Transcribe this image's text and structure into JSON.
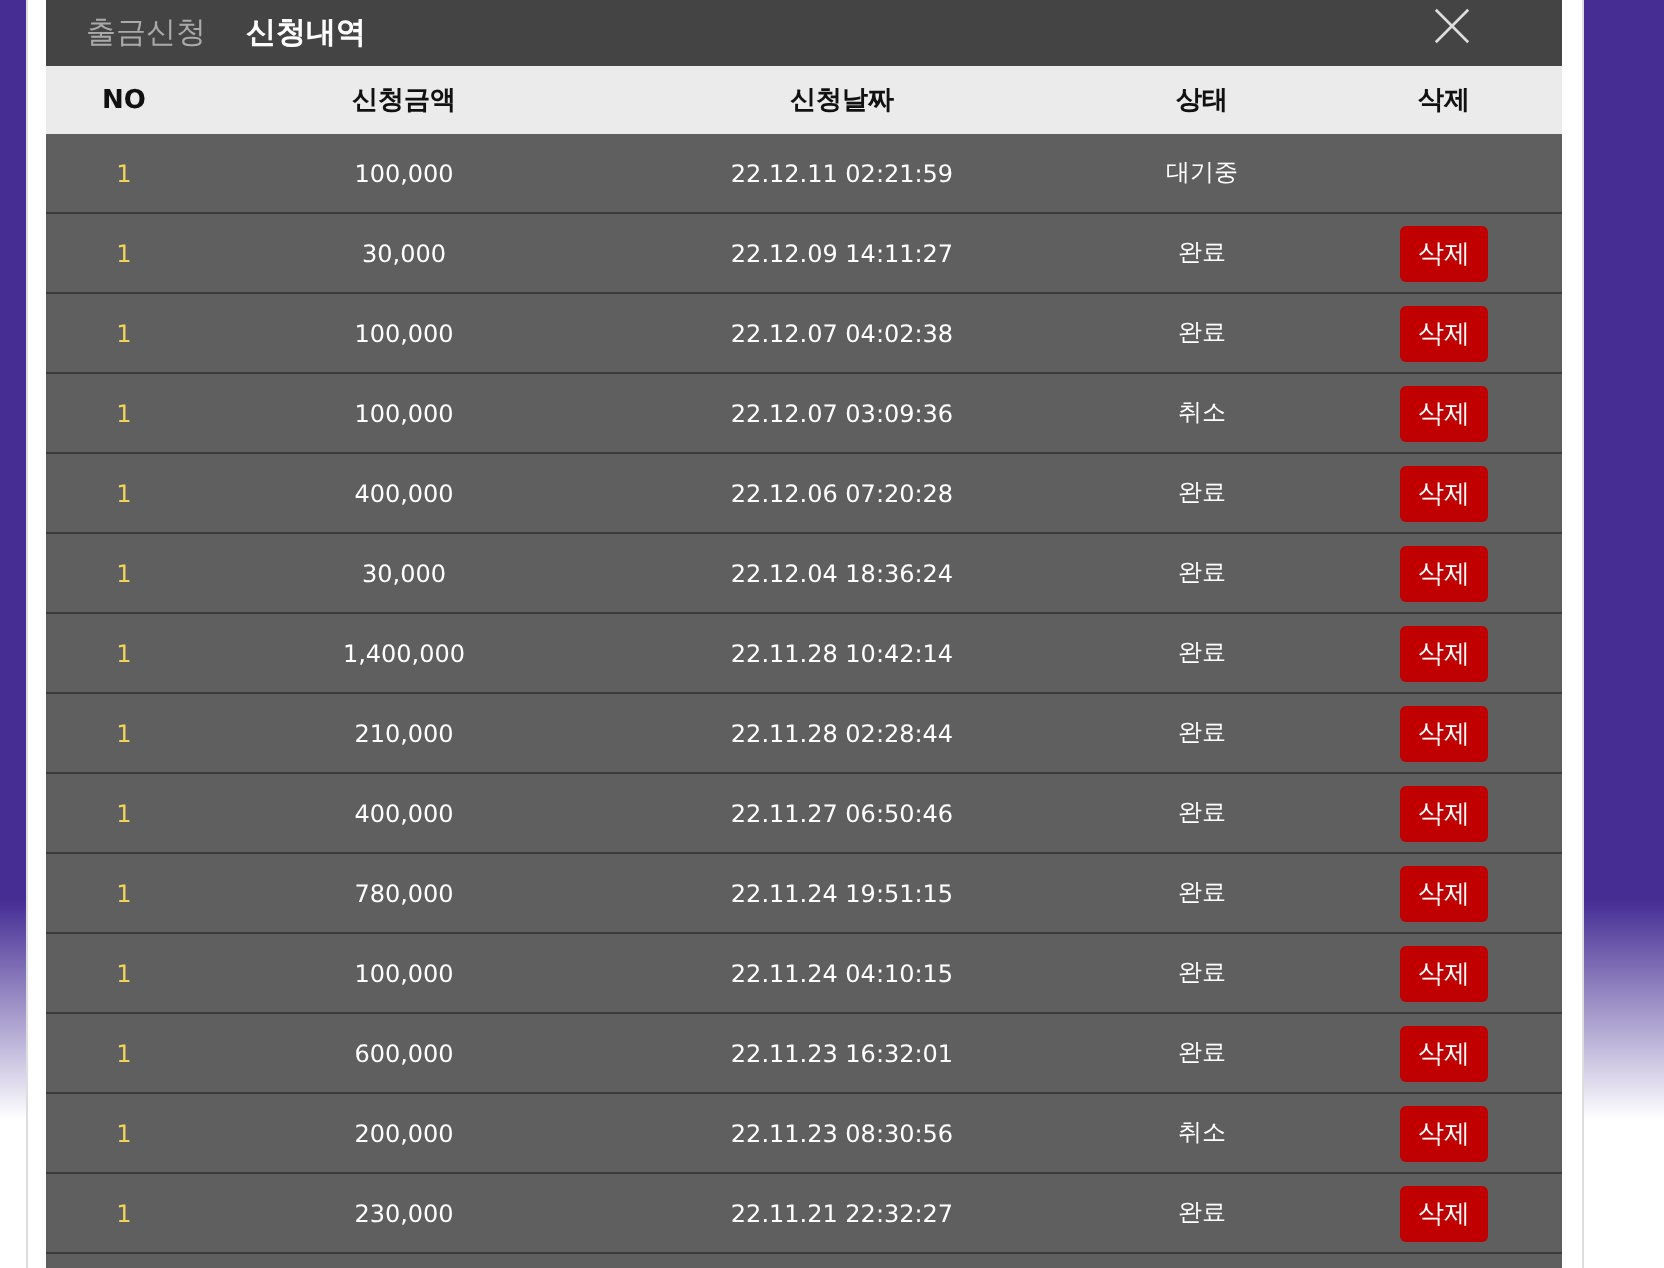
{
  "tabs": [
    {
      "label": "출금신청",
      "selected": false
    },
    {
      "label": "신청내역",
      "selected": true
    }
  ],
  "table": {
    "columns": [
      "NO",
      "신청금액",
      "신청날짜",
      "상태",
      "삭제"
    ],
    "rows": [
      {
        "no": "1",
        "amount": "100,000",
        "date": "22.12.11 02:21:59",
        "status": "대기중"
      },
      {
        "no": "1",
        "amount": "30,000",
        "date": "22.12.09 14:11:27",
        "status": "완료",
        "action": "삭제"
      },
      {
        "no": "1",
        "amount": "100,000",
        "date": "22.12.07 04:02:38",
        "status": "완료",
        "action": "삭제"
      },
      {
        "no": "1",
        "amount": "100,000",
        "date": "22.12.07 03:09:36",
        "status": "취소",
        "action": "삭제"
      },
      {
        "no": "1",
        "amount": "400,000",
        "date": "22.12.06 07:20:28",
        "status": "완료",
        "action": "삭제"
      },
      {
        "no": "1",
        "amount": "30,000",
        "date": "22.12.04 18:36:24",
        "status": "완료",
        "action": "삭제"
      },
      {
        "no": "1",
        "amount": "1,400,000",
        "date": "22.11.28 10:42:14",
        "status": "완료",
        "action": "삭제"
      },
      {
        "no": "1",
        "amount": "210,000",
        "date": "22.11.28 02:28:44",
        "status": "완료",
        "action": "삭제"
      },
      {
        "no": "1",
        "amount": "400,000",
        "date": "22.11.27 06:50:46",
        "status": "완료",
        "action": "삭제"
      },
      {
        "no": "1",
        "amount": "780,000",
        "date": "22.11.24 19:51:15",
        "status": "완료",
        "action": "삭제"
      },
      {
        "no": "1",
        "amount": "100,000",
        "date": "22.11.24 04:10:15",
        "status": "완료",
        "action": "삭제"
      },
      {
        "no": "1",
        "amount": "600,000",
        "date": "22.11.23 16:32:01",
        "status": "완료",
        "action": "삭제"
      },
      {
        "no": "1",
        "amount": "200,000",
        "date": "22.11.23 08:30:56",
        "status": "취소",
        "action": "삭제"
      },
      {
        "no": "1",
        "amount": "230,000",
        "date": "22.11.21 22:32:27",
        "status": "완료",
        "action": "삭제"
      }
    ]
  }
}
